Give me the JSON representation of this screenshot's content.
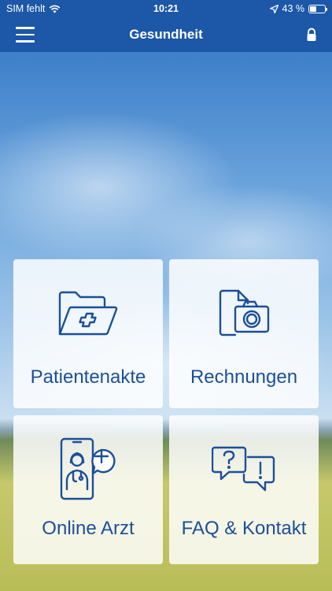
{
  "status_bar": {
    "carrier": "SIM fehlt",
    "time": "10:21",
    "battery_percent": "43 %",
    "battery_level": 0.43
  },
  "nav": {
    "title": "Gesundheit",
    "menu_icon": "hamburger-menu-icon",
    "lock_icon": "lock-icon"
  },
  "tiles": [
    {
      "label": "Patientenakte",
      "icon": "medical-folder-icon"
    },
    {
      "label": "Rechnungen",
      "icon": "document-camera-icon"
    },
    {
      "label": "Online Arzt",
      "icon": "phone-doctor-icon"
    },
    {
      "label": "FAQ & Kontakt",
      "icon": "question-exclamation-bubbles-icon"
    }
  ],
  "colors": {
    "brand_blue": "#1c57a8",
    "icon_blue": "#1c4f99",
    "tile_background": "#ffffff"
  }
}
